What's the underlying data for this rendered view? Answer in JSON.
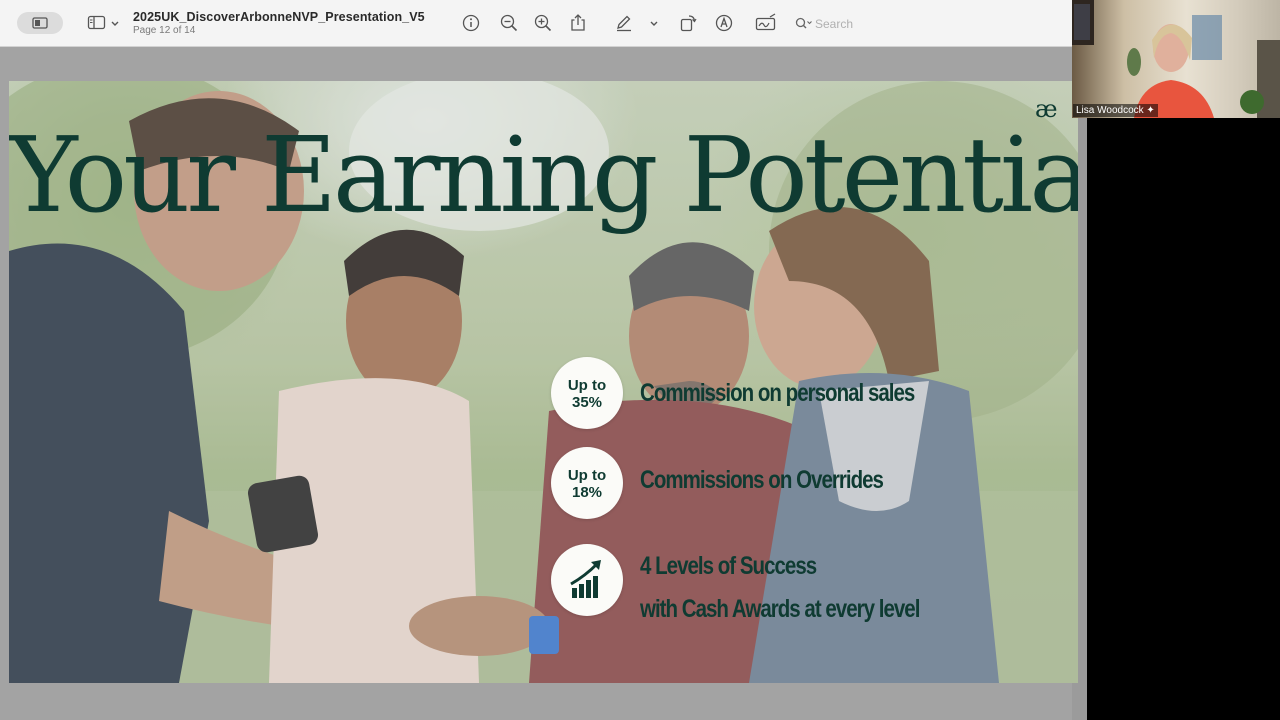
{
  "toolbar": {
    "document_title": "2025UK_DiscoverArbonneNVP_Presentation_V5",
    "page_indicator": "Page 12 of 14",
    "search_placeholder": "Search",
    "icons": [
      "sidebar-toggle-icon",
      "sidebar-icon",
      "chevron-down-icon",
      "info-icon",
      "zoom-out-icon",
      "zoom-in-icon",
      "share-icon",
      "markup-pen-icon",
      "chevron-down-icon",
      "rotate-icon",
      "markup-circle-icon",
      "signature-icon",
      "search-icon"
    ]
  },
  "slide": {
    "title": "Your Earning Potential",
    "logo": "æ",
    "features": [
      {
        "badge": [
          "Up to",
          "35%"
        ],
        "text": [
          "Commission on personal sales"
        ]
      },
      {
        "badge": [
          "Up to",
          "18%"
        ],
        "text": [
          "Commissions on Overrides"
        ]
      },
      {
        "badge_icon": "growth-chart-icon",
        "text": [
          "4 Levels of Success",
          "with Cash Awards at every level"
        ]
      }
    ],
    "colors": {
      "title": "#0f3b32",
      "badge_bg": "#fbfbf8"
    }
  },
  "video_call": {
    "participant_name": "Lisa Woodcock",
    "mic_status_icon": "sparkle-icon"
  }
}
